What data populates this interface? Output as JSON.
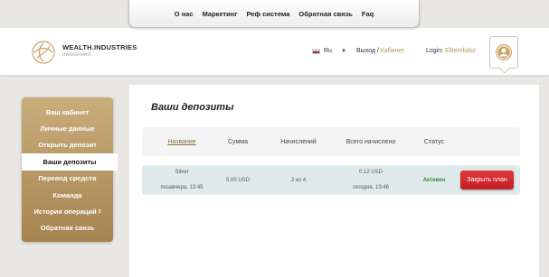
{
  "topnav": {
    "items": [
      "О нас",
      "Маркетинг",
      "Реф система",
      "Обратная связь",
      "Faq"
    ]
  },
  "header": {
    "brand_name": "WEALTH.INDUSTRIES",
    "brand_sub": "investment",
    "language": "Ru",
    "logout_label": "Выход",
    "cabinet_label": "Кабинет",
    "login_label": "Login:",
    "username": "EliteInfobiz"
  },
  "sidebar": {
    "items": [
      {
        "label": "Ваш кабинет"
      },
      {
        "label": "Личные данные"
      },
      {
        "label": "Открыть депозит"
      },
      {
        "label": "Ваши депозиты"
      },
      {
        "label": "Перевод средств"
      },
      {
        "label": "Команда"
      },
      {
        "label": "История операций",
        "badge": "3"
      },
      {
        "label": "Обратная связь"
      }
    ],
    "active_index": 3
  },
  "main": {
    "title": "Ваши депозиты",
    "columns": [
      "Название",
      "Сумма",
      "Начислений",
      "Всего начислено",
      "Статус"
    ],
    "rows": [
      {
        "name": "Silver",
        "date": "позавчера, 13:45",
        "amount": "5.00 USD",
        "accruals": "2 из 4",
        "total": "0.12 USD",
        "total_date": "сегодня, 13:46",
        "status": "Активен",
        "action": "Закрыть план"
      }
    ]
  },
  "colors": {
    "accent_gold": "#b8955b",
    "status_active": "#2f8b3a",
    "button_red": "#d32f2f",
    "row_bg": "#dfeaea"
  }
}
